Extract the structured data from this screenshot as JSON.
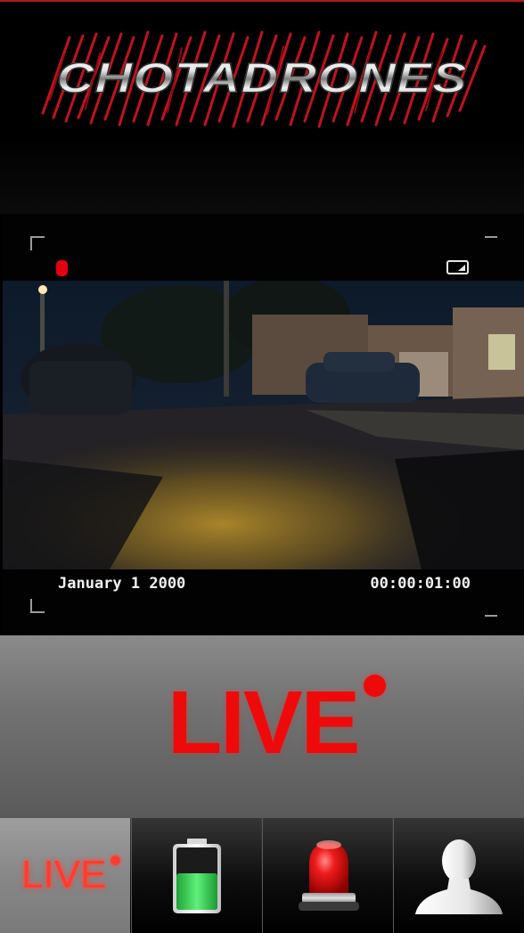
{
  "app": {
    "logo_text": "CHOTADRONES"
  },
  "camera": {
    "date": "January 1 2000",
    "timecode": "00:00:01:00",
    "recording_indicator": "red-dot",
    "battery_icon": "battery-icon"
  },
  "status": {
    "live_label": "LIVE"
  },
  "tabbar": {
    "tabs": [
      {
        "id": "live",
        "label": "LIVE",
        "icon": "live-icon",
        "active": true
      },
      {
        "id": "battery",
        "label": "",
        "icon": "battery-icon",
        "active": false
      },
      {
        "id": "alarm",
        "label": "",
        "icon": "siren-icon",
        "active": false
      },
      {
        "id": "profile",
        "label": "",
        "icon": "user-icon",
        "active": false
      }
    ]
  },
  "colors": {
    "accent_red": "#ee0a0a",
    "battery_green": "#2fd14a",
    "background": "#000000"
  }
}
